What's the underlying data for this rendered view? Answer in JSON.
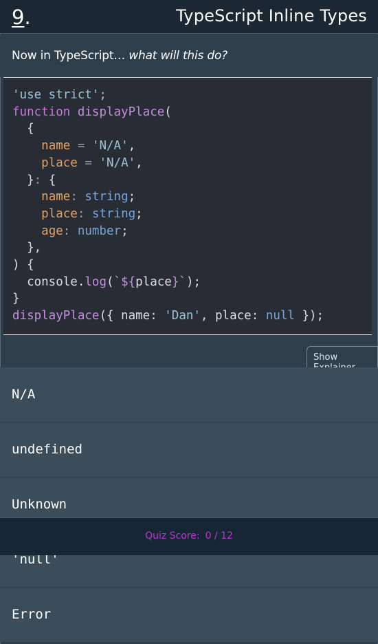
{
  "header": {
    "question_number": "9",
    "question_suffix": ".",
    "title": "TypeScript Inline Types"
  },
  "prompt": {
    "lead": "Now in TypeScript… ",
    "emphasis": "what will this do?"
  },
  "code": {
    "language": "typescript",
    "lines": [
      "'use strict';",
      "function displayPlace(",
      "  {",
      "    name = 'N/A',",
      "    place = 'N/A',",
      "  }: {",
      "    name: string;",
      "    place: string;",
      "    age: number;",
      "  },",
      ") {",
      "  console.log(`${place}`);",
      "}",
      "displayPlace({ name: 'Dan', place: null });"
    ]
  },
  "explainer_button": {
    "label": "Show Explainer"
  },
  "options": [
    {
      "label": "N/A"
    },
    {
      "label": "undefined"
    },
    {
      "label": "Unknown"
    },
    {
      "label": "'null'"
    },
    {
      "label": "Error"
    }
  ],
  "score": {
    "label": "Quiz Score:",
    "value": "0 / 12"
  },
  "colors": {
    "header_bg": "#1b2732",
    "page_bg": "#2f3e4b",
    "code_bg": "#282c34",
    "option_bg": "#3b4d5b",
    "score_bg": "#172634",
    "score_text": "#c033d6"
  }
}
